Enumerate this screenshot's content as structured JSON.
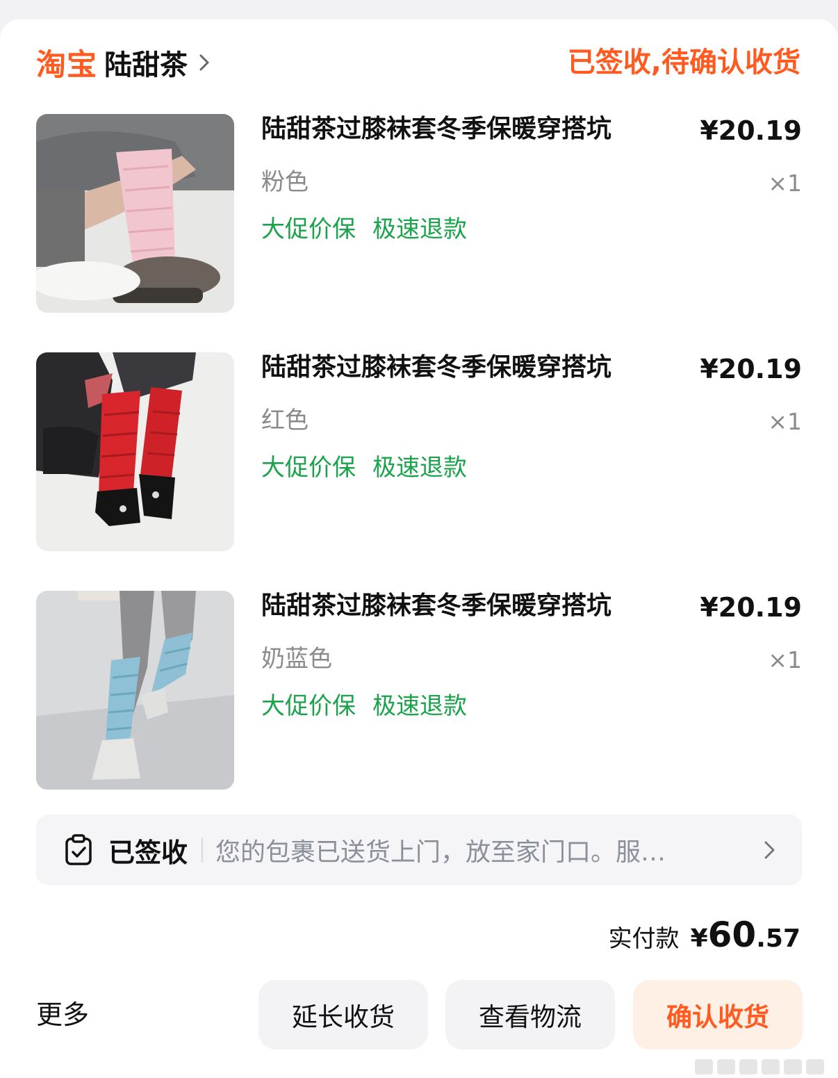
{
  "header": {
    "brand": "淘宝",
    "shop_name": "陆甜茶",
    "order_status": "已签收,待确认收货"
  },
  "items": [
    {
      "title": "陆甜茶过膝袜套冬季保暖穿搭坑",
      "price": "¥20.19",
      "variant": "粉色",
      "qty": "×1",
      "tags": [
        "大促价保",
        "极速退款"
      ],
      "image": "product-photo-pink-leg-warmers"
    },
    {
      "title": "陆甜茶过膝袜套冬季保暖穿搭坑",
      "price": "¥20.19",
      "variant": "红色",
      "qty": "×1",
      "tags": [
        "大促价保",
        "极速退款"
      ],
      "image": "product-photo-red-leg-warmers"
    },
    {
      "title": "陆甜茶过膝袜套冬季保暖穿搭坑",
      "price": "¥20.19",
      "variant": "奶蓝色",
      "qty": "×1",
      "tags": [
        "大促价保",
        "极速退款"
      ],
      "image": "product-photo-blue-leg-warmers"
    }
  ],
  "logistics": {
    "icon": "clipboard-check-icon",
    "status": "已签收",
    "message": "您的包裹已送货上门，放至家门口。服…"
  },
  "total": {
    "label": "实付款",
    "currency": "¥",
    "integer": "60",
    "decimal": ".57"
  },
  "actions": {
    "more": "更多",
    "extend": "延长收货",
    "logistics": "查看物流",
    "confirm": "确认收货"
  },
  "colors": {
    "accent": "#ff5a1f",
    "tag_green": "#1aa34a",
    "muted": "#8a8a8a"
  }
}
